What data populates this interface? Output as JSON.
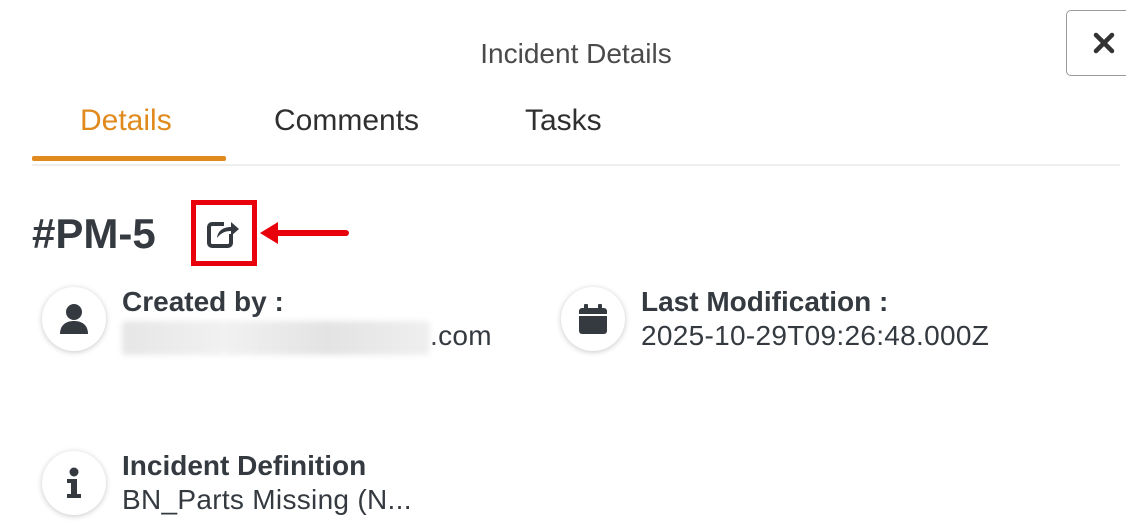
{
  "dialog": {
    "title": "Incident Details",
    "close_icon": "close-icon"
  },
  "tabs": [
    {
      "label": "Details",
      "active": true
    },
    {
      "label": "Comments",
      "active": false
    },
    {
      "label": "Tasks",
      "active": false
    }
  ],
  "incident": {
    "id": "#PM-5",
    "share_icon": "share-icon",
    "annotation_color": "#e8000b"
  },
  "fields": {
    "created_by": {
      "label": "Created by :",
      "value_suffix": ".com",
      "icon": "user-icon"
    },
    "last_modification": {
      "label": "Last Modification :",
      "value": "2025-10-29T09:26:48.000Z",
      "icon": "calendar-icon"
    },
    "incident_definition": {
      "label": "Incident Definition",
      "value": "BN_Parts Missing (N...",
      "icon": "info-icon"
    }
  },
  "colors": {
    "accent": "#e08a1e",
    "text": "#343a40"
  }
}
